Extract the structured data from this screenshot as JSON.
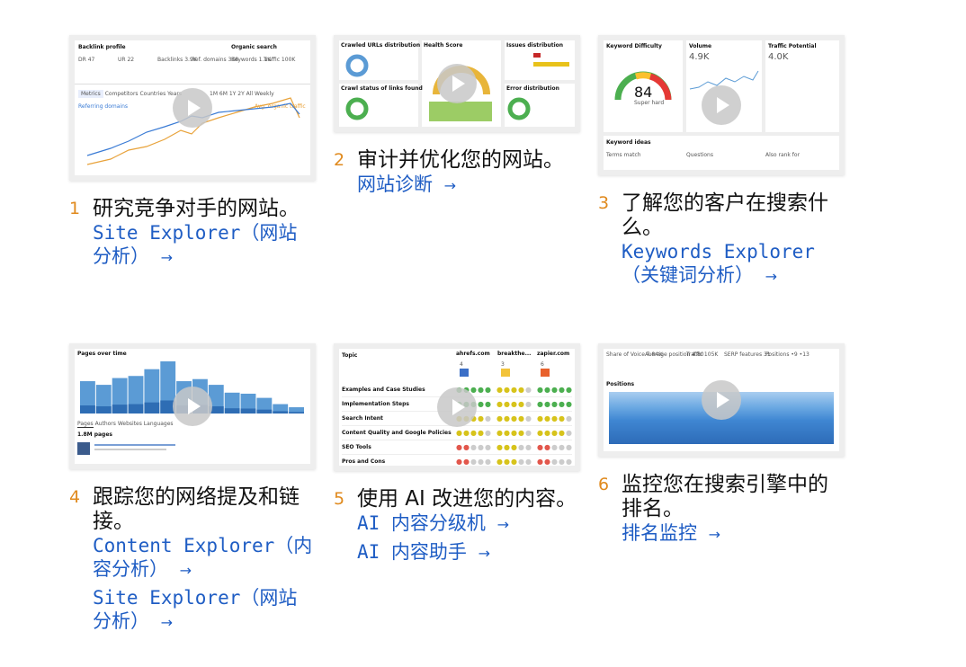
{
  "cards": [
    {
      "num": "1",
      "title": "研究竞争对手的网站。",
      "links": [
        {
          "label": "Site Explorer（网站分析）",
          "arrow": "→"
        }
      ],
      "thumb": {
        "title": "Backlink profile",
        "metrics": [
          "DR 47",
          "UR 22",
          "Backlinks 3.9K",
          "Ref. domains 338",
          "Keywords 1.1K",
          "Traffic 100K"
        ],
        "section": "Organic search",
        "tabs": [
          "Metrics",
          "Competitors",
          "Countries",
          "Years"
        ],
        "ranges": [
          "1M",
          "6M",
          "1Y",
          "2Y",
          "All",
          "Weekly"
        ],
        "series": [
          "Referring domains",
          "Avg. organic traffic"
        ]
      }
    },
    {
      "num": "2",
      "title": "审计并优化您的网站。",
      "links": [
        {
          "label": "网站诊断",
          "arrow": "→"
        }
      ],
      "thumb": {
        "panels": [
          "Crawled URLs distribution",
          "Health Score",
          "Issues distribution",
          "Crawl status of links found",
          "Error distribution"
        ]
      }
    },
    {
      "num": "3",
      "title": "了解您的客户在搜索什么。",
      "links": [
        {
          "label": "Keywords Explorer（关键词分析）",
          "arrow": "→"
        }
      ],
      "thumb": {
        "kd_label": "Keyword Difficulty",
        "kd": "84",
        "kd_text": "Super hard",
        "volume_label": "Volume",
        "volume": "4.9K",
        "tp_label": "Traffic Potential",
        "tp": "4.0K",
        "ideas": "Keyword ideas",
        "cols": [
          "Terms match",
          "Questions",
          "Also rank for"
        ]
      }
    },
    {
      "num": "4",
      "title": "跟踪您的网络提及和链接。",
      "links": [
        {
          "label": "Content Explorer（内容分析）",
          "arrow": "→"
        },
        {
          "label": "Site Explorer（网站分析）",
          "arrow": "→"
        }
      ],
      "thumb": {
        "header": "Pages over time",
        "tabs": [
          "Pages",
          "Authors",
          "Websites",
          "Languages"
        ],
        "count": "1.8M pages",
        "bars": [
          0.62,
          0.55,
          0.68,
          0.72,
          0.85,
          1.0,
          0.62,
          0.66,
          0.55,
          0.4,
          0.38,
          0.3,
          0.18,
          0.12
        ]
      }
    },
    {
      "num": "5",
      "title": "使用 AI 改进您的内容。",
      "links": [
        {
          "label": "AI 内容分级机",
          "arrow": "→"
        },
        {
          "label": "AI 内容助手",
          "arrow": "→"
        }
      ],
      "thumb": {
        "topic_header": "Topic",
        "sites": [
          "ahrefs.com",
          "breakthe...",
          "zapier.com"
        ],
        "site_nums": [
          "4",
          "3",
          "6"
        ],
        "rows": [
          {
            "topic": "Examples and Case Studies",
            "scores": [
              "ggggg",
              "yyyyx",
              "ggggg"
            ]
          },
          {
            "topic": "Implementation Steps",
            "scores": [
              "ggggg",
              "yyyyx",
              "ggggg"
            ]
          },
          {
            "topic": "Search Intent",
            "scores": [
              "yyyyx",
              "yyyyx",
              "yyyyx"
            ]
          },
          {
            "topic": "Content Quality and Google Policies",
            "scores": [
              "yyyyx",
              "yyyyx",
              "yyyyx"
            ]
          },
          {
            "topic": "SEO Tools",
            "scores": [
              "rrxxx",
              "yyyxx",
              "rrxxx"
            ]
          },
          {
            "topic": "Pros and Cons",
            "scores": [
              "rrxxx",
              "yyyxx",
              "rrxxx"
            ]
          }
        ]
      }
    },
    {
      "num": "6",
      "title": "监控您在搜索引擎中的排名。",
      "links": [
        {
          "label": "排名监控",
          "arrow": "→"
        }
      ],
      "thumb": {
        "metrics": [
          "Share of Voice 7.84%",
          "Average position 4.80",
          "Traffic 105K",
          "SERP features 31",
          "Positions •9 •13"
        ],
        "section": "Positions"
      }
    }
  ],
  "colors": {
    "number": "#e08a1e",
    "link": "#1f5dc4",
    "bar": "#5b9bd5",
    "bar_dark": "#2e6db4"
  }
}
